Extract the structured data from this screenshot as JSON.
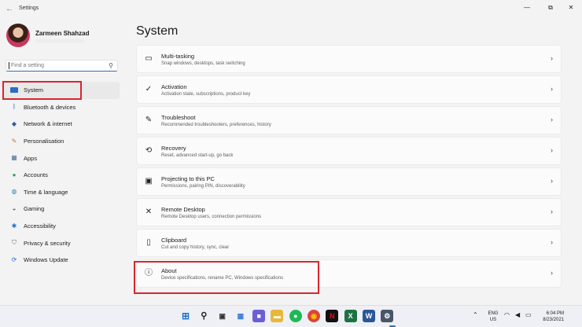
{
  "window": {
    "title": "Settings",
    "controls": [
      "—",
      "⧉",
      "✕"
    ]
  },
  "profile": {
    "name": "Zarmeen Shahzad"
  },
  "search": {
    "placeholder": "Find a setting"
  },
  "sidebar": {
    "items": [
      {
        "label": "System",
        "icon": "monitor-icon",
        "color": "#2b6cc4"
      },
      {
        "label": "Bluetooth & devices",
        "icon": "bluetooth-icon",
        "color": "#1f6fd0"
      },
      {
        "label": "Network & internet",
        "icon": "wifi-icon",
        "color": "#2f5aa8"
      },
      {
        "label": "Personalisation",
        "icon": "brush-icon",
        "color": "#d0782a"
      },
      {
        "label": "Apps",
        "icon": "apps-icon",
        "color": "#4d6e9a"
      },
      {
        "label": "Accounts",
        "icon": "person-icon",
        "color": "#2ca06a"
      },
      {
        "label": "Time & language",
        "icon": "globe-icon",
        "color": "#2b86c9"
      },
      {
        "label": "Gaming",
        "icon": "gamepad-icon",
        "color": "#6a6a6a"
      },
      {
        "label": "Accessibility",
        "icon": "accessibility-icon",
        "color": "#1f6fd0"
      },
      {
        "label": "Privacy & security",
        "icon": "shield-icon",
        "color": "#6a6a6a"
      },
      {
        "label": "Windows Update",
        "icon": "update-icon",
        "color": "#1f6fd0"
      }
    ]
  },
  "main": {
    "title": "System",
    "cards": [
      {
        "title": "Multi-tasking",
        "desc": "Snap windows, desktops, task switching",
        "icon": "multitasking-icon",
        "glyph": "▭"
      },
      {
        "title": "Activation",
        "desc": "Activation state, subscriptions, product key",
        "icon": "check-circle-icon",
        "glyph": "✓"
      },
      {
        "title": "Troubleshoot",
        "desc": "Recommended troubleshooters, preferences, history",
        "icon": "wrench-icon",
        "glyph": "✎"
      },
      {
        "title": "Recovery",
        "desc": "Reset, advanced start-up, go back",
        "icon": "recovery-icon",
        "glyph": "⟲"
      },
      {
        "title": "Projecting to this PC",
        "desc": "Permissions, pairing PIN, discoverability",
        "icon": "projector-icon",
        "glyph": "▣"
      },
      {
        "title": "Remote Desktop",
        "desc": "Remote Desktop users, connection permissions",
        "icon": "remote-desktop-icon",
        "glyph": "✕"
      },
      {
        "title": "Clipboard",
        "desc": "Cut and copy history, sync, clear",
        "icon": "clipboard-icon",
        "glyph": "▯"
      },
      {
        "title": "About",
        "desc": "Device specifications, rename PC, Windows specifications",
        "icon": "info-icon",
        "glyph": "ⓘ"
      }
    ]
  },
  "taskbar": {
    "apps": [
      {
        "icon": "start-icon",
        "glyph": "⊞",
        "color": "#1f6fd0"
      },
      {
        "icon": "search-icon",
        "glyph": "⚲",
        "color": "#222222"
      },
      {
        "icon": "task-view-icon",
        "glyph": "▣",
        "color": "#333333"
      },
      {
        "icon": "widgets-icon",
        "glyph": "▦",
        "color": "#3a7bd5"
      },
      {
        "icon": "teams-chat-icon",
        "glyph": "■",
        "color": "#6b5fd3"
      },
      {
        "icon": "file-explorer-icon",
        "glyph": "▬",
        "color": "#e8b83a"
      },
      {
        "icon": "spotify-icon",
        "glyph": "●",
        "color": "#1db954"
      },
      {
        "icon": "chrome-icon",
        "glyph": "◉",
        "color": "#d9443b"
      },
      {
        "icon": "netflix-icon",
        "glyph": "N",
        "color": "#111111"
      },
      {
        "icon": "excel-icon",
        "glyph": "X",
        "color": "#1e7145"
      },
      {
        "icon": "word-icon",
        "glyph": "W",
        "color": "#2b579a"
      },
      {
        "icon": "settings-icon",
        "glyph": "⚙",
        "color": "#4a5568"
      }
    ],
    "lang_top": "ENG",
    "lang_bottom": "US",
    "time": "6:04 PM",
    "date": "8/23/2021"
  }
}
